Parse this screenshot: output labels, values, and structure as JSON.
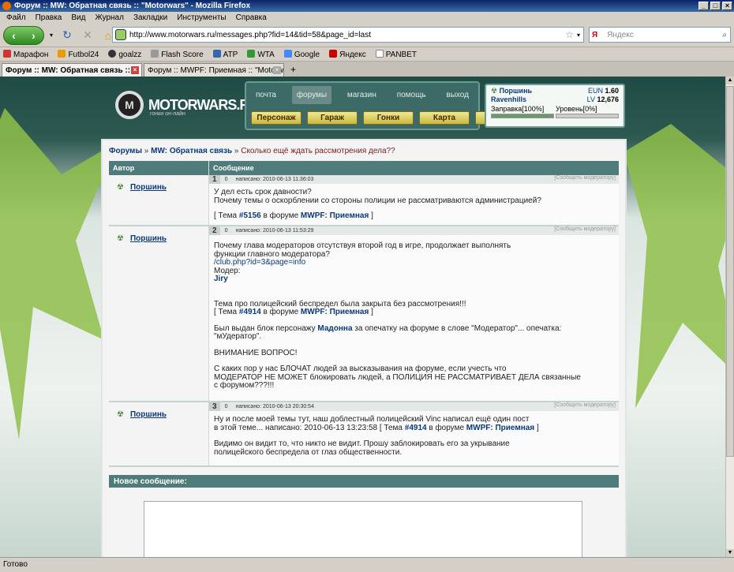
{
  "window": {
    "title": "Форум :: MW: Обратная связь :: \"Motorwars\" - Mozilla Firefox"
  },
  "menu": [
    "Файл",
    "Правка",
    "Вид",
    "Журнал",
    "Закладки",
    "Инструменты",
    "Справка"
  ],
  "address": {
    "url": "http://www.motorwars.ru/messages.php?fid=14&tid=58&page_id=last"
  },
  "search": {
    "engine": "Я",
    "placeholder": "Яндекс"
  },
  "bookmarks": [
    "Марафон",
    "Futbol24",
    "goalzz",
    "Flash Score",
    "ATP",
    "WTA",
    "Google",
    "Яндекс",
    "PANBET"
  ],
  "tabs": [
    {
      "label": "Форум :: MW: Обратная связь :: ..."
    },
    {
      "label": "Форум :: MWPF: Приемная :: \"Motorw...\""
    }
  ],
  "status": "Готово",
  "site": {
    "logo_text": "MOTORWARS.RU",
    "logo_sub": "гонки он-лайн",
    "nav": [
      "почта",
      "форумы",
      "магазин",
      "помощь",
      "выход"
    ],
    "subnav": [
      "Персонаж",
      "Гараж",
      "Гонки",
      "Карта",
      "Рулетка"
    ],
    "player": {
      "name": "Поршинь",
      "team": "Ravenhills",
      "eun_label": "EUN",
      "eun": "1.60",
      "lv_label": "LV",
      "lv": "12,676",
      "fuel_label": "Заправка[100%]",
      "fuel": 1.0,
      "level_label": "Уровень[0%]",
      "level": 0.0
    }
  },
  "breadcrumb": {
    "forums": "Форумы",
    "sep1": " » ",
    "section": "MW: Обратная связь",
    "sep2": " » ",
    "topic": "Сколько ещё ждать рассмотрения дела??"
  },
  "table": {
    "col_author": "Автор",
    "col_message": "Сообщение"
  },
  "posts": [
    {
      "num": "1",
      "zero": "0",
      "author": "Поршинь",
      "date": "написано: 2010-06-13 11:36:03",
      "report": "[Сообщить модератору]",
      "lines": [
        "У дел есть срок давности?",
        "Почему темы о оскорблении со стороны полиции не рассматриваются администрацией?"
      ],
      "ref_open": "[ Тема ",
      "ref_num": "#5156",
      "ref_mid": " в форуме ",
      "ref_forum": "MWPF: Приемная",
      "ref_close": " ]"
    },
    {
      "num": "2",
      "zero": "0",
      "author": "Поршинь",
      "date": "написано: 2010-06-13 11:53:29",
      "report": "[Сообщить модератору]",
      "p1": [
        "Почему глава модераторов отсутствуя второй год в игре, продолжает выполнять",
        "функции главного модератора?"
      ],
      "link": "/club.php?id=3&page=info",
      "moder_label": "Модер:",
      "moder_name": "Jiry",
      "p2": "Тема про полицейский беспредел была закрыта без рассмотрения!!!",
      "ref_open": "[ Тема ",
      "ref_num": "#4914",
      "ref_mid": " в форуме ",
      "ref_forum": "MWPF: Приемная",
      "ref_close": " ]",
      "p3_a": "Был выдан блок персонажу ",
      "p3_name": "Мадонна",
      "p3_b": " за опечатку на форуме в слове \"Модератор\"... опечатка:",
      "p3_c": "\"мУдератор\".",
      "p4": "ВНИМАНИЕ ВОПРОС!",
      "p5": [
        "С каких пор у нас БЛОЧАТ людей за высказывания на форуме, если учесть что",
        "МОДЕРАТОР НЕ МОЖЕТ блокировать людей, а ПОЛИЦИЯ НЕ РАССМАТРИВАЕТ ДЕЛА связанные",
        "с форумом???!!!"
      ]
    },
    {
      "num": "3",
      "zero": "0",
      "author": "Поршинь",
      "date": "написано: 2010-06-13 20:30:54",
      "report": "[Сообщить модератору]",
      "l1": "Ну и после моей темы тут, наш доблестный полицейский Vinc написал ещё один пост",
      "l2_a": "в этой теме... написано: 2010-06-13 13:23:58 ",
      "ref_open": "[ Тема ",
      "ref_num": "#4914",
      "ref_mid": " в форуме ",
      "ref_forum": "MWPF: Приемная",
      "ref_close": " ]",
      "l3": [
        "Видимо он видит то, что никто не видит. Прошу заблокировать его за укрывание",
        "полицейского беспредела от глаз общественности."
      ]
    }
  ],
  "new_message": {
    "label": "Новое сообщение:"
  }
}
